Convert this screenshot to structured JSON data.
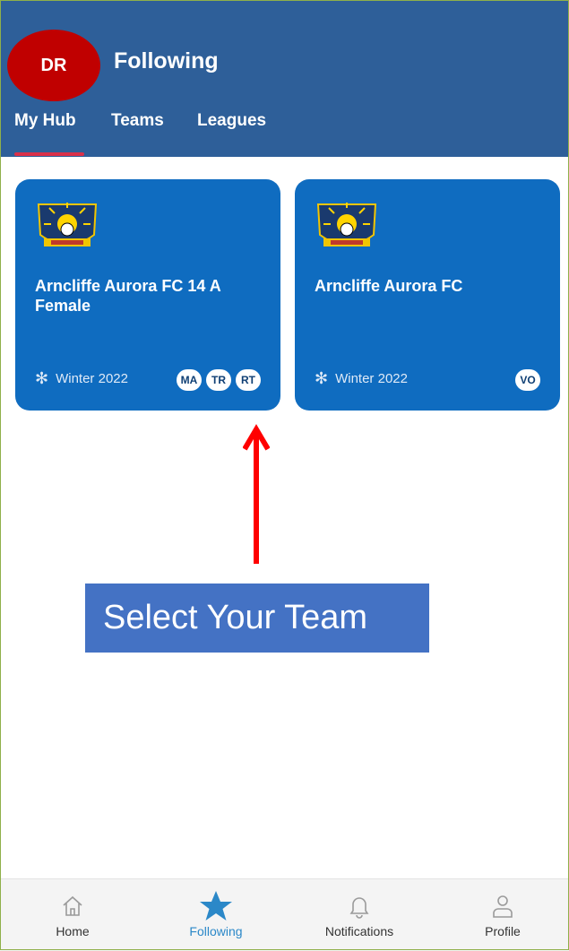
{
  "header": {
    "avatar_initials": "DR",
    "title": "Following",
    "tabs": [
      {
        "label": "My Hub",
        "active": true
      },
      {
        "label": "Teams",
        "active": false
      },
      {
        "label": "Leagues",
        "active": false
      }
    ]
  },
  "cards": [
    {
      "crest_icon": "aurora-crest-icon",
      "name": "Arncliffe Aurora FC 14 A Female",
      "season": "Winter 2022",
      "badges": [
        "MA",
        "TR",
        "RT"
      ]
    },
    {
      "crest_icon": "aurora-crest-icon",
      "name": "Arncliffe Aurora FC",
      "season": "Winter 2022",
      "badges": [
        "VO"
      ]
    }
  ],
  "annotation": {
    "text": "Select Your Team"
  },
  "bottom_nav": [
    {
      "label": "Home",
      "icon": "home-icon"
    },
    {
      "label": "Following",
      "icon": "star-icon",
      "active": true
    },
    {
      "label": "Notifications",
      "icon": "bell-icon"
    },
    {
      "label": "Profile",
      "icon": "profile-icon"
    }
  ],
  "colors": {
    "header_bg": "#2e5f99",
    "card_bg": "#0f6cc0",
    "avatar_bg": "#c00000",
    "tab_indicator": "#d9304a",
    "callout_bg": "#4472c4",
    "arrow": "#ff0000",
    "nav_active": "#2b88c8"
  }
}
